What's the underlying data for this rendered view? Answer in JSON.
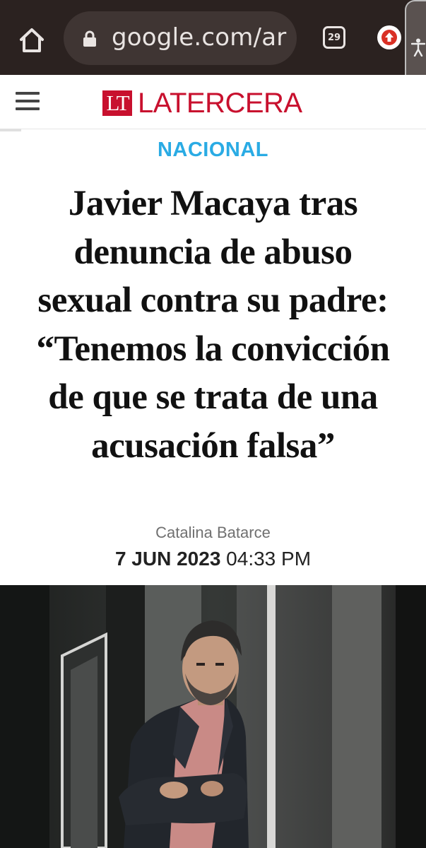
{
  "browser": {
    "url": "google.com/ar",
    "tab_count": "29",
    "icons": [
      "home-icon",
      "lock-icon",
      "tabs-icon",
      "update-icon",
      "accessibility-icon"
    ]
  },
  "site": {
    "logo_mark": "LT",
    "logo_text": "LATERCERA",
    "brand_color": "#c8102e"
  },
  "article": {
    "section": "NACIONAL",
    "section_color": "#2aabe4",
    "headline_lines": [
      "Javier Macaya tras",
      "denuncia de abuso",
      "sexual contra su padre:",
      "“Tenemos la convicción",
      "de que se trata de una",
      "acusación falsa”"
    ],
    "author": "Catalina Batarce",
    "date": "7 JUN 2023",
    "time": "04:33 PM"
  }
}
